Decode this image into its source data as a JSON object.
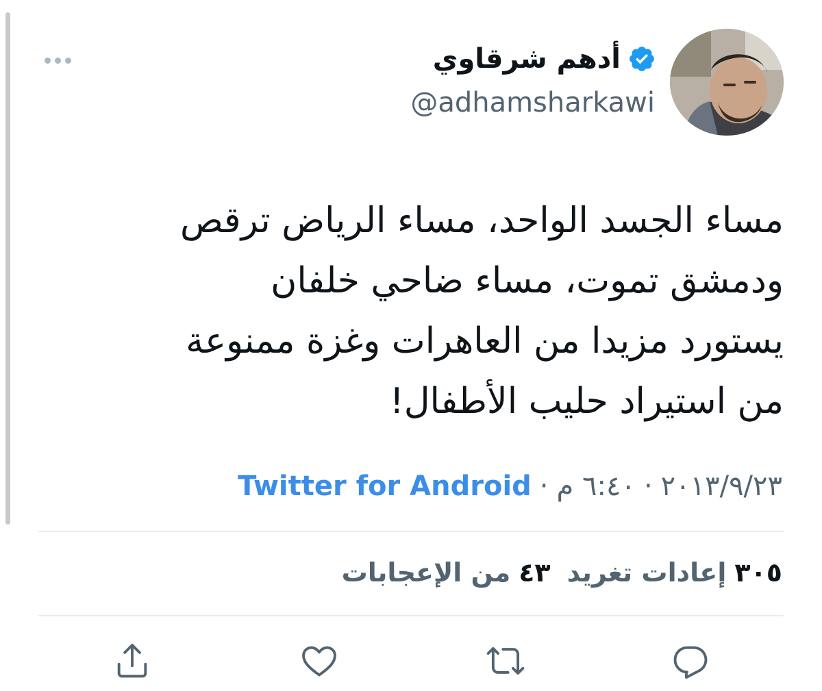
{
  "author": {
    "display_name": "أدهم شرقاوي",
    "handle": "@adhamsharkawi",
    "verified": true,
    "avatar_icon": "profile-photo"
  },
  "tweet": {
    "text": "مساء الجسد الواحد،  مساء الرياض ترقص\nودمشق تموت،  مساء ضاحي خلفان\nيستورد مزيدا من العاهرات وغزة ممنوعة\nمن استيراد حليب الأطفال!"
  },
  "meta": {
    "date": "٢٠١٣/٩/٢٣",
    "separator": "·",
    "time": "٦:٤٠ م",
    "source": "Twitter for Android"
  },
  "stats": {
    "retweets_count": "٣٠٥",
    "retweets_label": "إعادات تغريد",
    "likes_count": "٤٣",
    "likes_label": "من الإعجابات"
  },
  "actions": {
    "reply_icon": "reply-icon",
    "retweet_icon": "retweet-icon",
    "like_icon": "heart-icon",
    "share_icon": "share-icon"
  },
  "colors": {
    "link_blue": "#3b8ee8",
    "verified_blue": "#1d9bf0",
    "secondary_text": "#536471",
    "divider": "#e6ecf0"
  }
}
